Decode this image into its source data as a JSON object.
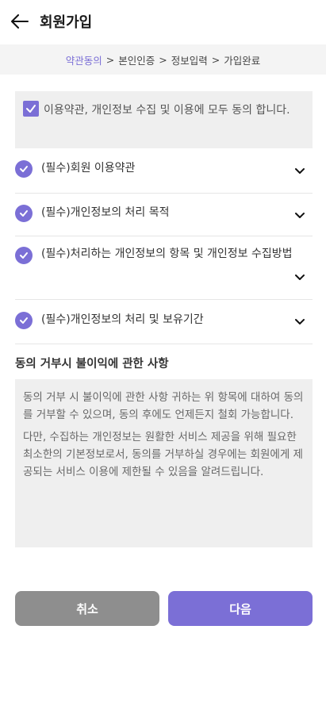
{
  "header": {
    "title": "회원가입",
    "back_icon": "arrow-left-icon"
  },
  "steps": [
    {
      "label": "약관동의",
      "active": true
    },
    {
      "label": "본인인증",
      "active": false
    },
    {
      "label": "정보입력",
      "active": false
    },
    {
      "label": "가입완료",
      "active": false
    }
  ],
  "step_separator": ">",
  "agree_all": {
    "label": "이용약관, 개인정보 수집 및 이용에 모두 동의 합니다.",
    "checked": true
  },
  "terms": [
    {
      "label": "(필수)회원 이용약관",
      "checked": true
    },
    {
      "label": "(필수)개인정보의 처리 목적",
      "checked": true
    },
    {
      "label": "(필수)처리하는 개인정보의 항목 및 개인정보 수집방법",
      "checked": true
    },
    {
      "label": "(필수)개인정보의 처리 및 보유기간",
      "checked": true
    }
  ],
  "notice": {
    "title": "동의 거부시 불이익에 관한 사항",
    "paragraphs": [
      "동의 거부 시 불이익에 관한 사항 귀하는 위 항목에 대하여 동의를 거부할 수 있으며, 동의 후에도 언제든지 철회 가능합니다.",
      "다만, 수집하는 개인정보는 원활한 서비스 제공을 위해 필요한 최소한의 기본정보로서, 동의를 거부하실 경우에는 회원에게 제공되는 서비스 이용에 제한될 수 있음을 알려드립니다."
    ]
  },
  "buttons": {
    "cancel": "취소",
    "next": "다음"
  },
  "colors": {
    "accent": "#7b6fd6",
    "cancel": "#8e8e8e",
    "box_bg": "#efefef",
    "steps_bg": "#f4f4f4"
  }
}
